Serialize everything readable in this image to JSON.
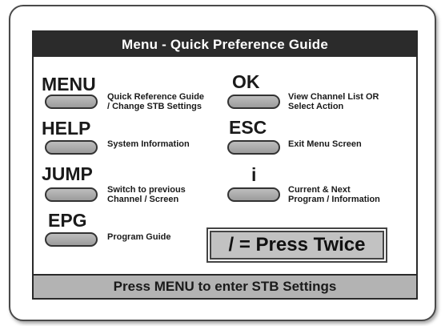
{
  "panel": {
    "title": "Menu - Quick Preference Guide",
    "footer": "Press MENU to enter STB Settings"
  },
  "keys": {
    "menu": {
      "label": "MENU",
      "description": "Quick Reference Guide\n/ Change STB Settings"
    },
    "help": {
      "label": "HELP",
      "description": "System Information"
    },
    "jump": {
      "label": "JUMP",
      "description": "Switch to previous\nChannel / Screen"
    },
    "epg": {
      "label": "EPG",
      "description": "Program Guide"
    },
    "ok": {
      "label": "OK",
      "description": "View Channel List OR\nSelect Action"
    },
    "esc": {
      "label": "ESC",
      "description": "Exit Menu Screen"
    },
    "info": {
      "label": "i",
      "description": "Current & Next\nProgram / Information"
    }
  },
  "note": {
    "press_twice": "/ = Press Twice"
  }
}
